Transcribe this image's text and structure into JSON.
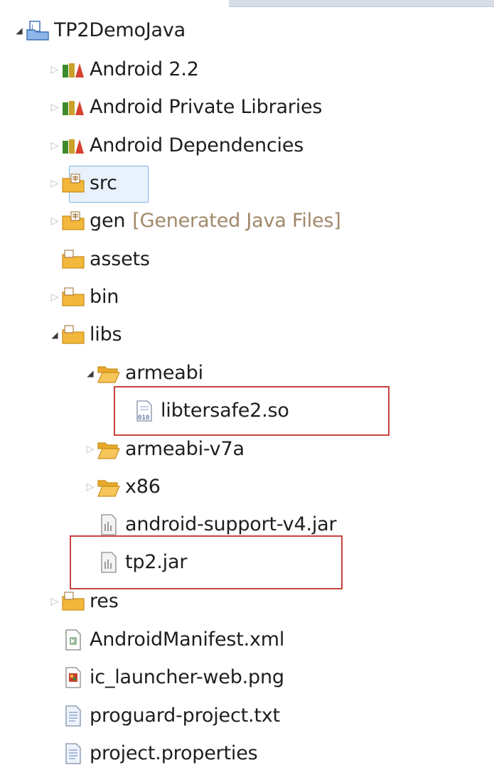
{
  "tree": {
    "project": "TP2DemoJava",
    "libraries": [
      "Android 2.2",
      "Android Private Libraries",
      "Android Dependencies"
    ],
    "src": "src",
    "gen": {
      "label": "gen",
      "decoration": "[Generated Java Files]"
    },
    "assets": "assets",
    "bin": "bin",
    "libs": {
      "label": "libs",
      "armeabi": {
        "label": "armeabi",
        "file": "libtersafe2.so"
      },
      "armeabi_v7a": "armeabi-v7a",
      "x86": "x86",
      "android_support_jar": "android-support-v4.jar",
      "tp2_jar": "tp2.jar"
    },
    "res": "res",
    "manifest": "AndroidManifest.xml",
    "launcher": "ic_launcher-web.png",
    "proguard": "proguard-project.txt",
    "properties": "project.properties"
  },
  "colors": {
    "selection": "#e9f2fc",
    "selection_border": "#7db3e8",
    "highlight_box": "#c8443f",
    "decoration_text": "#a0886a",
    "folder": "#f2b73b"
  },
  "icons": {
    "project": "java-project-icon",
    "library": "library-container-icon",
    "source_folder": "source-folder-icon",
    "folder": "folder-icon",
    "so_file": "binary-file-icon",
    "jar_file": "jar-file-icon",
    "xml_file": "xml-file-icon",
    "png_file": "image-file-icon",
    "text_file": "text-file-icon"
  }
}
